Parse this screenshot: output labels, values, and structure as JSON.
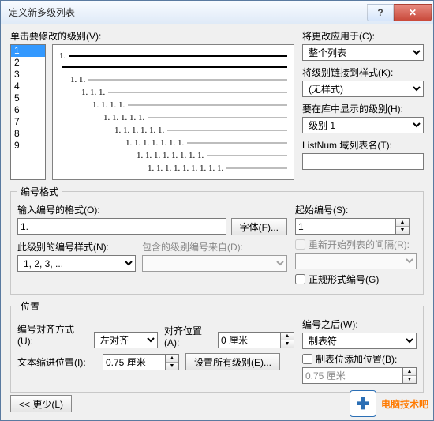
{
  "window": {
    "title": "定义新多级列表",
    "help": "?",
    "close": "✕"
  },
  "levelList": {
    "label": "单击要修改的级别(V):",
    "items": [
      "1",
      "2",
      "3",
      "4",
      "5",
      "6",
      "7",
      "8",
      "9"
    ],
    "selected": "1"
  },
  "preview": {
    "rows": [
      {
        "indent": 0,
        "num": "1.",
        "dark": true
      },
      {
        "indent": 0,
        "num": "",
        "dark": true
      },
      {
        "indent": 1,
        "num": "1. 1."
      },
      {
        "indent": 2,
        "num": "1. 1. 1."
      },
      {
        "indent": 3,
        "num": "1. 1. 1. 1."
      },
      {
        "indent": 4,
        "num": "1. 1. 1. 1. 1."
      },
      {
        "indent": 5,
        "num": "1. 1. 1. 1. 1. 1."
      },
      {
        "indent": 6,
        "num": "1. 1. 1. 1. 1. 1. 1."
      },
      {
        "indent": 7,
        "num": "1. 1. 1. 1. 1. 1. 1. 1."
      },
      {
        "indent": 8,
        "num": "1. 1. 1. 1. 1. 1. 1. 1. 1."
      }
    ]
  },
  "right": {
    "applyTo": {
      "label": "将更改应用于(C):",
      "value": "整个列表"
    },
    "linkStyle": {
      "label": "将级别链接到样式(K):",
      "value": "(无样式)"
    },
    "showLevel": {
      "label": "要在库中显示的级别(H):",
      "value": "级别 1"
    },
    "listNum": {
      "label": "ListNum 域列表名(T):",
      "value": ""
    }
  },
  "numberFormat": {
    "legend": "编号格式",
    "enterFormat": {
      "label": "输入编号的格式(O):",
      "value": "1."
    },
    "fontBtn": "字体(F)...",
    "styleLabel": "此级别的编号样式(N):",
    "styleValue": "1, 2, 3, ...",
    "includeLabel": "包含的级别编号来自(D):",
    "startAt": {
      "label": "起始编号(S):",
      "value": "1"
    },
    "restart": {
      "label": "重新开始列表的间隔(R):"
    },
    "legalFormat": "正规形式编号(G)"
  },
  "position": {
    "legend": "位置",
    "alignLabel": "编号对齐方式(U):",
    "alignValue": "左对齐",
    "alignAtLabel": "对齐位置(A):",
    "alignAtValue": "0 厘米",
    "indentLabel": "文本缩进位置(I):",
    "indentValue": "0.75 厘米",
    "setAllBtn": "设置所有级别(E)...",
    "afterLabel": "编号之后(W):",
    "afterValue": "制表符",
    "tabStop": {
      "label": "制表位添加位置(B):",
      "value": "0.75 厘米"
    }
  },
  "lessBtn": "<< 更少(L)",
  "watermark": "电脑技术吧"
}
